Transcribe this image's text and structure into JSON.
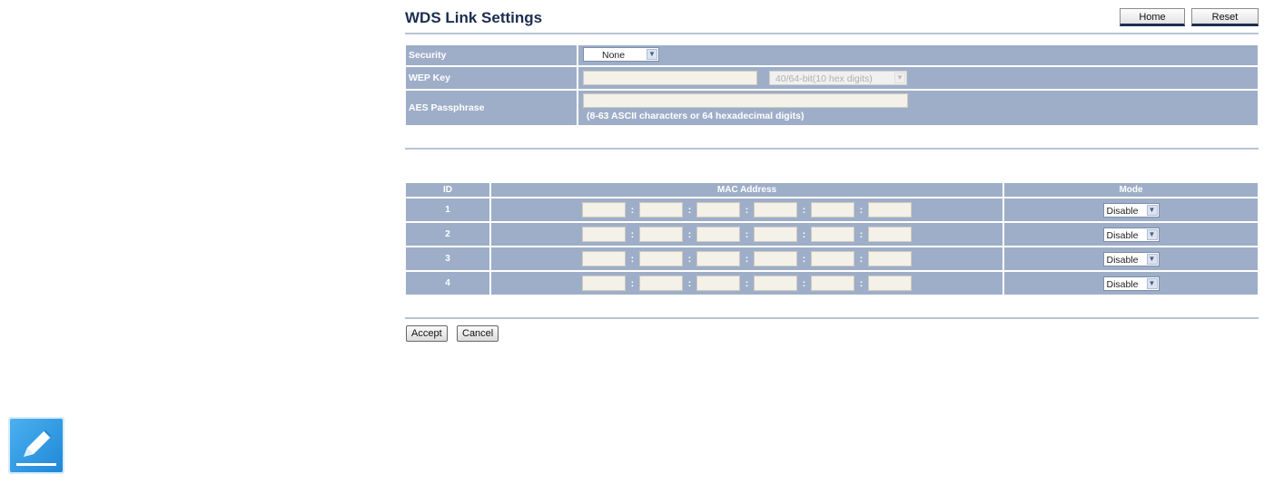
{
  "page": {
    "title": "WDS Link Settings"
  },
  "header": {
    "home_label": "Home",
    "reset_label": "Reset"
  },
  "security": {
    "security_label": "Security",
    "security_value": "None",
    "wep_key_label": "WEP Key",
    "wep_key_length": "40/64-bit(10 hex digits)",
    "aes_label": "AES Passphrase",
    "aes_hint": "(8-63 ASCII characters or 64 hexadecimal digits)"
  },
  "wds_table": {
    "headers": {
      "id": "ID",
      "mac": "MAC Address",
      "mode": "Mode"
    },
    "colon": ":",
    "rows": [
      {
        "id": "1",
        "mode": "Disable"
      },
      {
        "id": "2",
        "mode": "Disable"
      },
      {
        "id": "3",
        "mode": "Disable"
      },
      {
        "id": "4",
        "mode": "Disable"
      }
    ]
  },
  "actions": {
    "accept_label": "Accept",
    "cancel_label": "Cancel"
  },
  "icons": {
    "note": "pencil-note-icon",
    "dropdown": "chevron-down-icon"
  },
  "colors": {
    "title": "#1c2e4f",
    "table_bg": "#9eaec8",
    "input_bg": "#f4f1e9",
    "note_icon": "#2f9be6"
  }
}
